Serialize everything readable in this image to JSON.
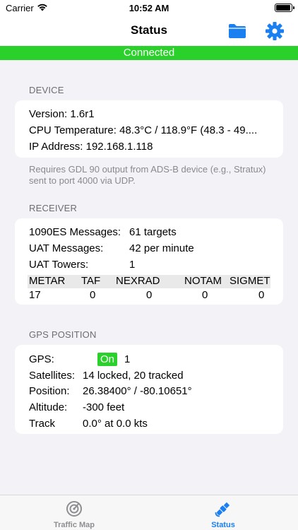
{
  "status_bar": {
    "carrier": "Carrier",
    "time": "10:52 AM"
  },
  "nav": {
    "title": "Status",
    "folder_icon": "folder-icon",
    "gear_icon": "gear-icon"
  },
  "banner": {
    "text": "Connected",
    "color": "#2bd12b"
  },
  "device": {
    "header": "DEVICE",
    "version": "Version: 1.6r1",
    "cpu": "CPU Temperature: 48.3°C / 118.9°F (48.3 - 49....",
    "ip": "IP Address: 192.168.1.118",
    "footnote": "Requires GDL 90 output from ADS-B device (e.g., Stratux) sent to port 4000 via UDP."
  },
  "receiver": {
    "header": "RECEIVER",
    "rows": [
      {
        "label": "1090ES Messages:",
        "value": "61 targets"
      },
      {
        "label": "UAT Messages:",
        "value": "42 per minute"
      },
      {
        "label": "UAT Towers:",
        "value": "1"
      }
    ],
    "table": {
      "columns": [
        "METAR",
        "TAF",
        "NEXRAD",
        "NOTAM",
        "SIGMET"
      ],
      "values": [
        "17",
        "0",
        "0",
        "0",
        "0"
      ]
    }
  },
  "gps": {
    "header": "GPS POSITION",
    "gps_label": "GPS:",
    "gps_status": "On",
    "gps_count": "1",
    "satellites_label": "Satellites:",
    "satellites_value": "14 locked, 20 tracked",
    "position_label": "Position:",
    "position_value": "26.38400° / -80.10651°",
    "altitude_label": "Altitude:",
    "altitude_value": "-300 feet",
    "track_label": "Track",
    "track_value": "0.0° at 0.0 kts"
  },
  "tabs": [
    {
      "label": "Traffic Map",
      "icon": "radar-icon",
      "selected": false
    },
    {
      "label": "Status",
      "icon": "satellite-icon",
      "selected": true
    }
  ],
  "colors": {
    "accent": "#1a7ff0",
    "status_green": "#2bd12b"
  }
}
